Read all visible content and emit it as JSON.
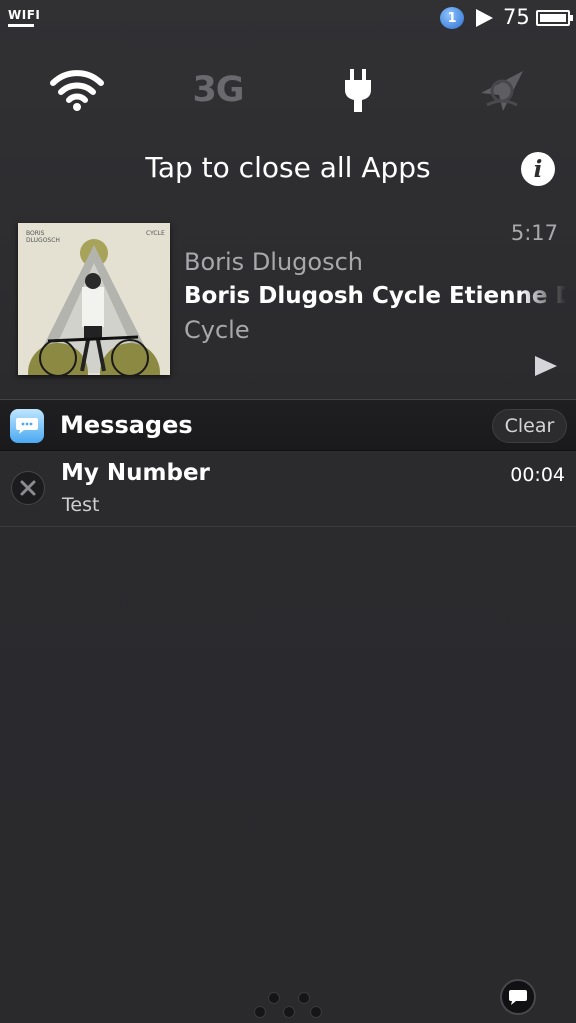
{
  "status_bar": {
    "carrier": "WIFI",
    "badge_count": "1",
    "battery_percent": "75",
    "icons": [
      "wifi-label",
      "notification-badge-icon",
      "play-icon",
      "battery-icon"
    ]
  },
  "toggles": {
    "wifi": {
      "icon": "wifi-icon",
      "active": true
    },
    "cellular": {
      "label": "3G",
      "active": false
    },
    "power": {
      "icon": "power-plug-icon",
      "active": true
    },
    "location": {
      "icon": "location-icon",
      "active": false
    }
  },
  "close_apps": {
    "label": "Tap to close all Apps",
    "info_icon": "info-icon"
  },
  "now_playing": {
    "time": "5:17",
    "artist": "Boris Dlugosch",
    "title": "Boris Dlugosh Cycle Etienne De Crecy Remix",
    "album": "Cycle",
    "art_text_left": "BORIS\nDLUGOSCH",
    "art_text_right": "CYCLE",
    "play_icon": "play-icon"
  },
  "messages": {
    "header": "Messages",
    "clear_label": "Clear",
    "items": [
      {
        "sender": "My Number",
        "time": "00:04",
        "body": "Test"
      }
    ]
  },
  "bottom": {
    "page_dots_icon": "page-dots-icon",
    "chat_icon": "chat-bubble-icon"
  },
  "colors": {
    "background": "#2b2b2e",
    "header_bg": "#1c1c1e",
    "text_secondary": "#a8a8ac",
    "disabled_toggle": "#6a6a6e"
  }
}
